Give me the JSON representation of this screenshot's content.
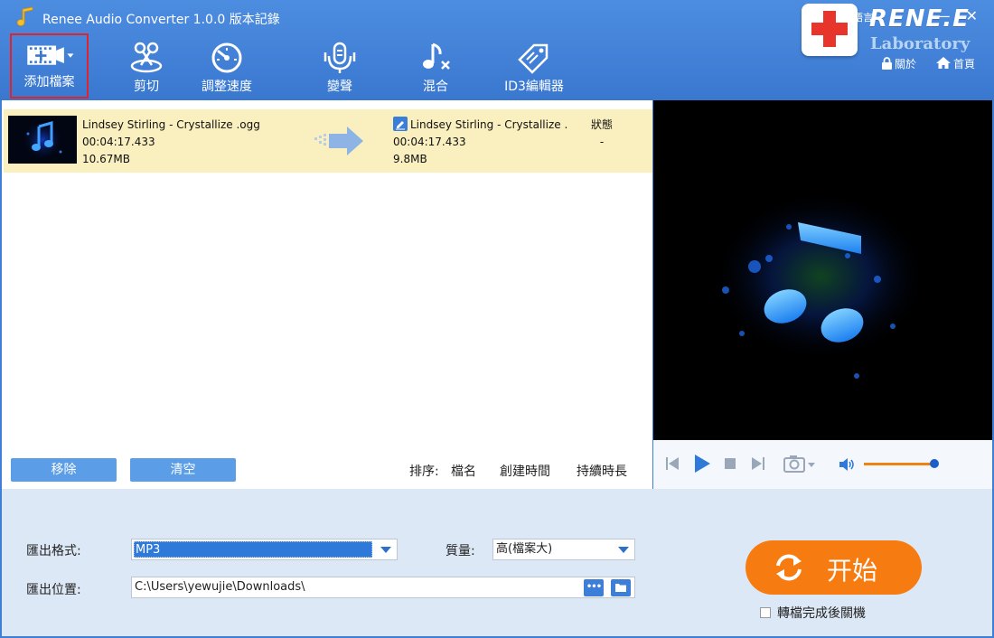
{
  "app": {
    "title": "Renee Audio Converter 1.0.0 版本記錄"
  },
  "toolbar": [
    {
      "id": "add",
      "label": "添加檔案",
      "icon": "add-file-icon"
    },
    {
      "id": "cut",
      "label": "剪切",
      "icon": "scissors-icon"
    },
    {
      "id": "speed",
      "label": "調整速度",
      "icon": "speedometer-icon"
    },
    {
      "id": "voice",
      "label": "變聲",
      "icon": "microphone-icon"
    },
    {
      "id": "mix",
      "label": "混合",
      "icon": "music-note-icon"
    },
    {
      "id": "id3",
      "label": "ID3編輯器",
      "icon": "tag-icon"
    }
  ],
  "header_right": {
    "language_fragment": "語言",
    "logo_text": "RENE.E",
    "logo_sub": "Laboratory",
    "about": "關於",
    "home": "首頁",
    "window_buttons": [
      "—",
      "✕"
    ]
  },
  "file": {
    "source_name": "Lindsey Stirling - Crystallize .ogg",
    "source_duration": "00:04:17.433",
    "source_size": "10.67MB",
    "output_name": "Lindsey Stirling - Crystallize .",
    "output_duration": "00:04:17.433",
    "output_size": "9.8MB",
    "status_header": "狀態",
    "status_value": "-"
  },
  "list_actions": {
    "remove": "移除",
    "clear": "清空"
  },
  "sort": {
    "label": "排序:",
    "options": [
      "檔名",
      "創建時間",
      "持續時長"
    ]
  },
  "settings": {
    "format_label": "匯出格式:",
    "format_value": "MP3",
    "quality_label": "質量:",
    "quality_value": "高(檔案大)",
    "path_label": "匯出位置:",
    "path_value": "C:\\Users\\yewujie\\Downloads\\",
    "browse_label": "•••"
  },
  "start": {
    "label": "开始"
  },
  "shutdown": {
    "label": "轉檔完成後關機",
    "checked": false
  },
  "player": {
    "volume": 0.92
  }
}
